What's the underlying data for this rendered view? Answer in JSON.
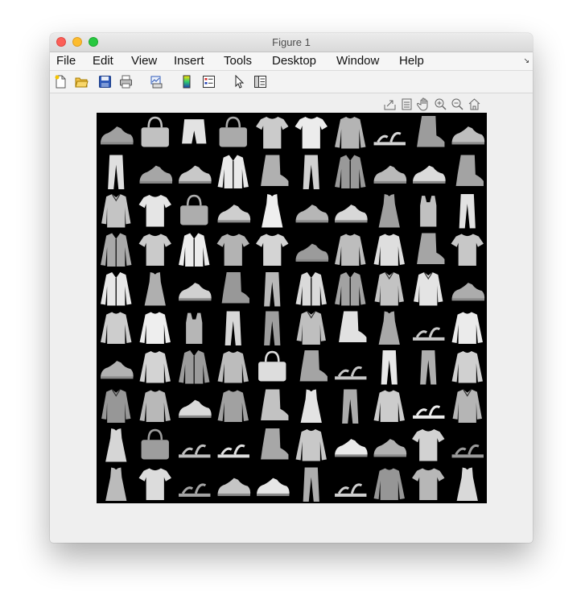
{
  "window": {
    "title": "Figure 1"
  },
  "menu": {
    "items": [
      {
        "label": "File"
      },
      {
        "label": "Edit"
      },
      {
        "label": "View"
      },
      {
        "label": "Insert"
      },
      {
        "label": "Tools"
      },
      {
        "label": "Desktop"
      },
      {
        "label": "Window"
      },
      {
        "label": "Help"
      }
    ],
    "corner_glyph": "↘"
  },
  "toolbar": {
    "icons": [
      "new-figure-icon",
      "open-file-icon",
      "save-icon",
      "print-icon",
      "link-plot-icon",
      "insert-colorbar-icon",
      "insert-legend-icon",
      "edit-plot-icon",
      "open-property-inspector-icon"
    ]
  },
  "axes_toolbar": {
    "icons": [
      "export-icon",
      "brush-icon",
      "pan-icon",
      "zoom-in-icon",
      "zoom-out-icon",
      "home-icon"
    ]
  },
  "image_grid": {
    "rows": 10,
    "cols": 10,
    "cells": [
      "sneaker",
      "bag",
      "shorts",
      "bag",
      "tshirt",
      "tshirt",
      "pullover",
      "sandal",
      "boot",
      "sneaker",
      "trouser",
      "sneaker",
      "sneaker",
      "coat",
      "boot",
      "trouser",
      "coat",
      "sneaker",
      "sneaker",
      "boot",
      "shirt",
      "tshirt",
      "bag",
      "sneaker",
      "dress",
      "sneaker",
      "sneaker",
      "dress",
      "top",
      "trouser",
      "coat",
      "tshirt",
      "coat",
      "tshirt",
      "tshirt",
      "sneaker",
      "pullover",
      "pullover",
      "boot",
      "tshirt",
      "coat",
      "dress",
      "sneaker",
      "boot",
      "trouser",
      "coat",
      "coat",
      "shirt",
      "shirt",
      "sneaker",
      "pullover",
      "pullover",
      "top",
      "trouser",
      "trouser",
      "shirt",
      "boot",
      "dress",
      "sandal",
      "pullover",
      "sneaker",
      "pullover",
      "coat",
      "pullover",
      "bag",
      "boot",
      "sandal",
      "trouser",
      "trouser",
      "pullover",
      "shirt",
      "pullover",
      "sneaker",
      "pullover",
      "boot",
      "dress",
      "trouser",
      "pullover",
      "sandal",
      "shirt",
      "dress",
      "bag",
      "sandal",
      "sandal",
      "boot",
      "pullover",
      "sneaker",
      "sneaker",
      "tshirt",
      "sandal",
      "dress",
      "tshirt",
      "sandal",
      "sneaker",
      "sneaker",
      "trouser",
      "sandal",
      "pullover",
      "tshirt",
      "dress"
    ]
  }
}
